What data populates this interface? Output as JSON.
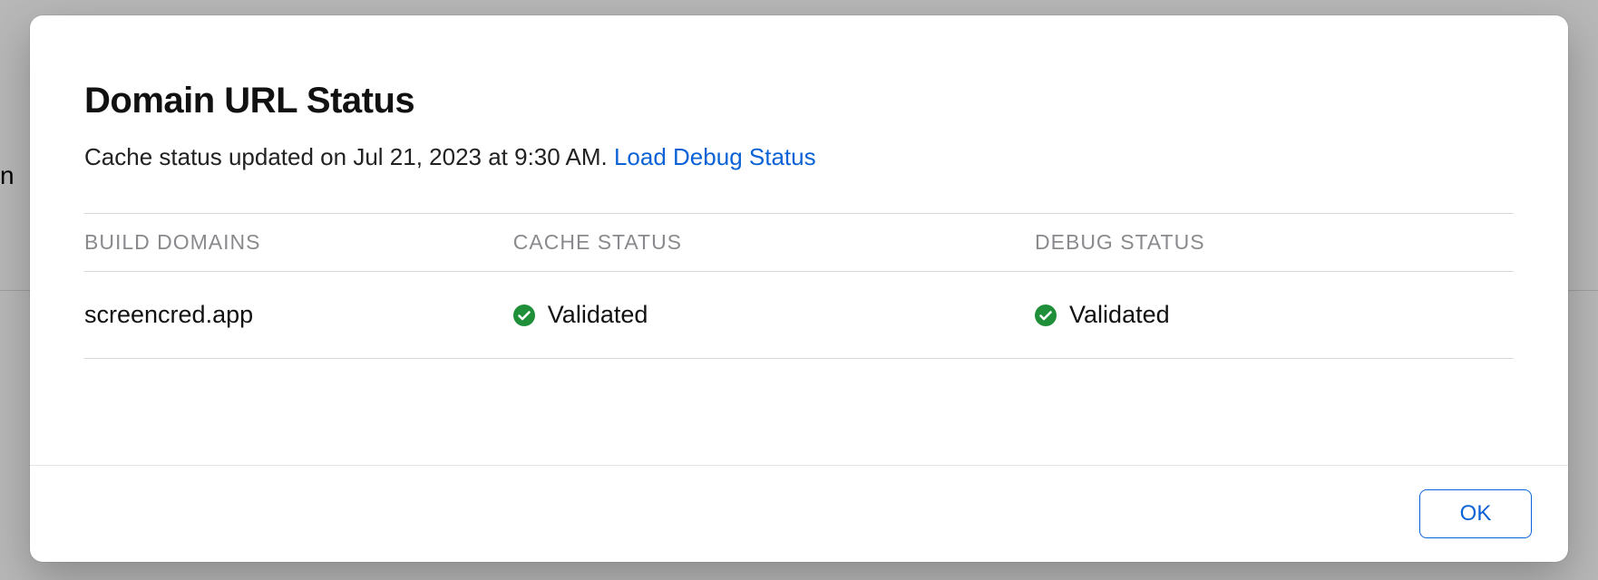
{
  "background": {
    "partial_text": "n"
  },
  "dialog": {
    "title": "Domain URL Status",
    "cache_status_text": "Cache status updated on Jul 21, 2023 at 9:30 AM. ",
    "load_debug_link": "Load Debug Status",
    "table": {
      "headers": {
        "build_domains": "BUILD DOMAINS",
        "cache_status": "CACHE STATUS",
        "debug_status": "DEBUG STATUS"
      },
      "rows": [
        {
          "domain": "screencred.app",
          "cache_status": "Validated",
          "debug_status": "Validated"
        }
      ]
    },
    "ok_button": "OK"
  },
  "colors": {
    "link": "#0b62d6",
    "success": "#1f8f3a"
  }
}
